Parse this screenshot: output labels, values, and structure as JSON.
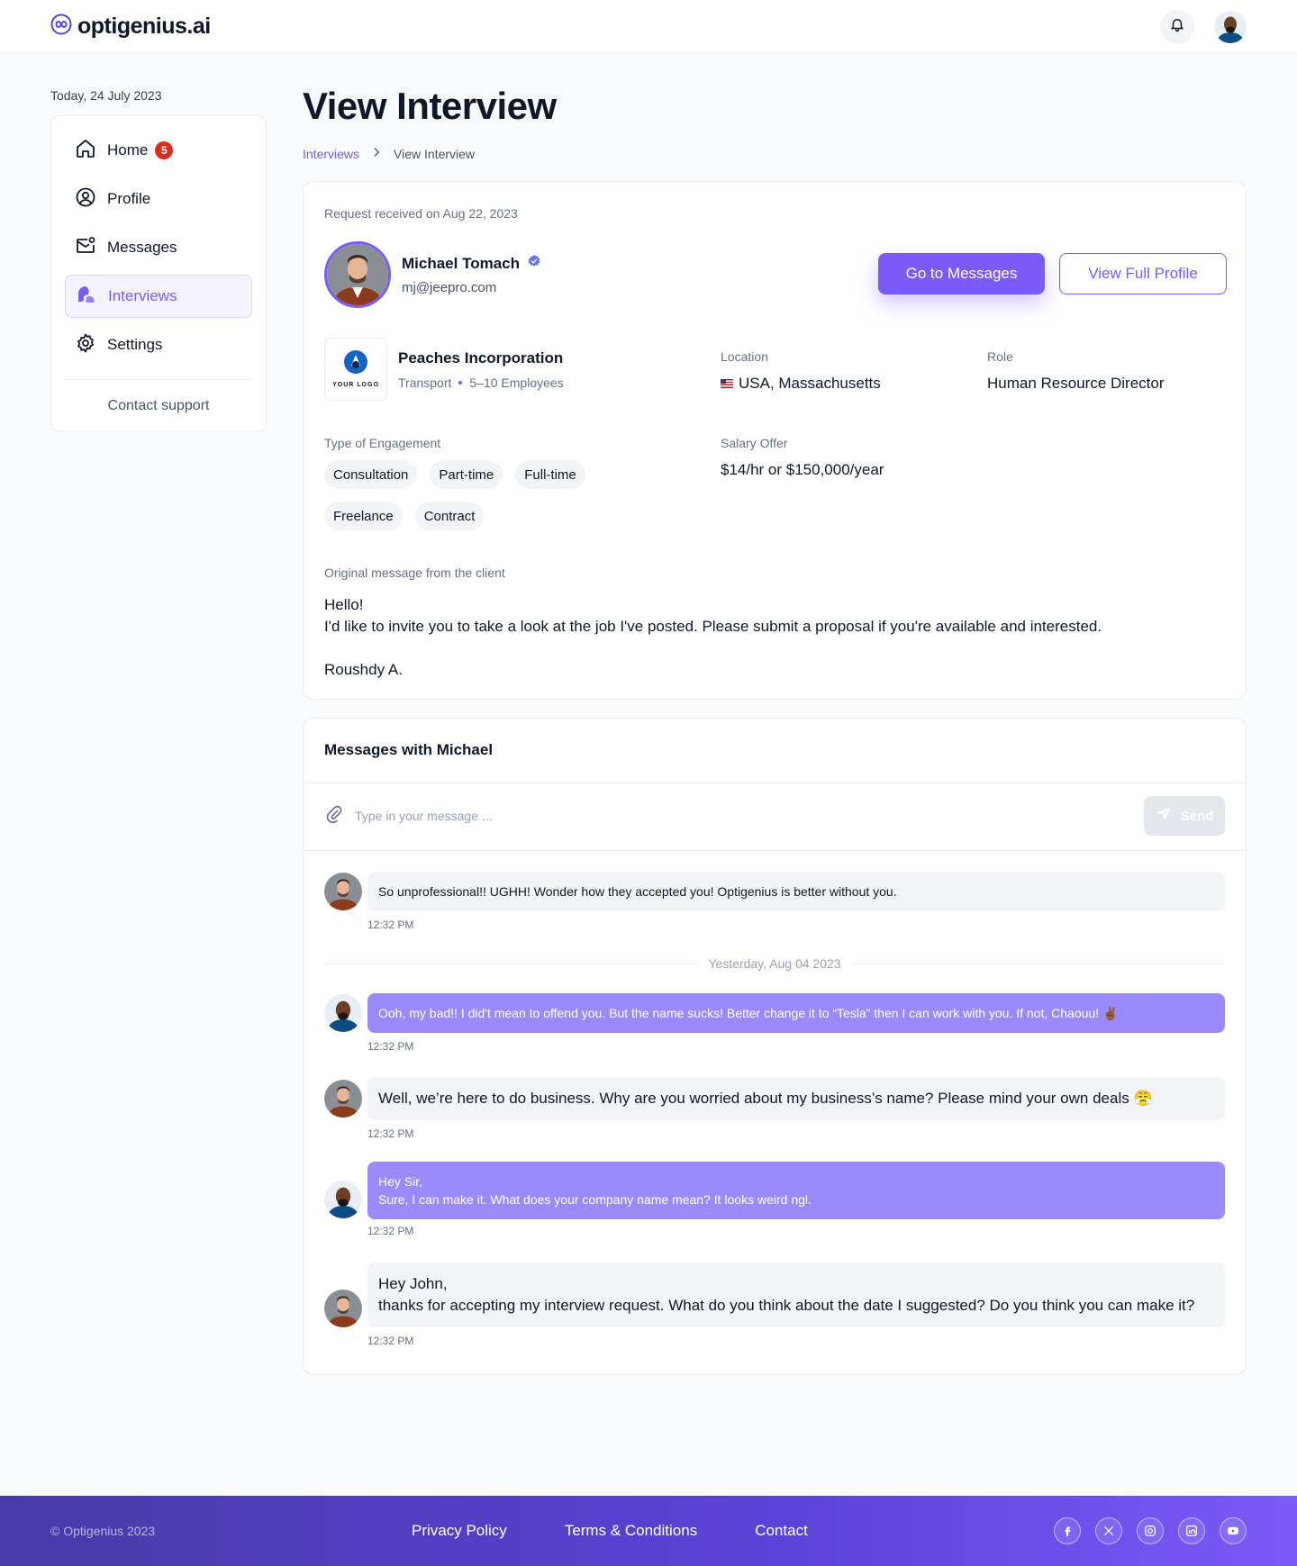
{
  "header": {
    "brand": "optigenius.ai",
    "icons": {
      "logo": "infinity-logo-icon",
      "notifications": "bell-icon"
    }
  },
  "sidebar": {
    "today": "Today, 24 July 2023",
    "items": [
      {
        "label": "Home",
        "icon": "home-icon",
        "badge": "5"
      },
      {
        "label": "Profile",
        "icon": "user-circle-icon"
      },
      {
        "label": "Messages",
        "icon": "mail-icon"
      },
      {
        "label": "Interviews",
        "icon": "interviews-icon",
        "active": true
      },
      {
        "label": "Settings",
        "icon": "gear-icon"
      }
    ],
    "contact_support": "Contact support"
  },
  "page": {
    "title": "View Interview",
    "breadcrumb": {
      "parent": "Interviews",
      "current": "View Interview"
    }
  },
  "interview": {
    "request_received": "Request received on Aug 22, 2023",
    "candidate": {
      "name": "Michael Tomach",
      "email": "mj@jeepro.com",
      "verified": true
    },
    "buttons": {
      "go_to_messages": "Go to Messages",
      "view_full_profile": "View Full Profile"
    },
    "company": {
      "logo_text": "YOUR LOGO",
      "name": "Peaches Incorporation",
      "industry": "Transport",
      "size": "5–10 Employees"
    },
    "location": {
      "label": "Location",
      "value": "USA, Massachusetts"
    },
    "role": {
      "label": "Role",
      "value": "Human Resource Director"
    },
    "engagement": {
      "label": "Type of Engagement",
      "types": [
        "Consultation",
        "Part-time",
        "Full-time",
        "Freelance",
        "Contract"
      ]
    },
    "salary": {
      "label": "Salary Offer",
      "value": "$14/hr or $150,000/year"
    },
    "original_message": {
      "label": "Original message from the client",
      "greeting": "Hello!",
      "body": "I'd like to invite you to take a look at the job I've posted. Please submit a proposal if you're available and interested.",
      "signature": "Roushdy A."
    }
  },
  "messages": {
    "title": "Messages with Michael",
    "compose_placeholder": "Type in your message ...",
    "send_label": "Send",
    "day_separator": "Yesterday, Aug 04 2023",
    "items": [
      {
        "from": "michael",
        "lines": [
          "So unprofessional!! UGHH! Wonder how  they accepted you! Optigenius is better without you."
        ],
        "time": "12:32 PM"
      },
      {
        "from": "me",
        "lines": [
          "Ooh, my bad!! I did't mean to offend you. But the name sucks! Better change it to “Tesla” then I can work with you. If not, Chaouu! ✌🏾"
        ],
        "time": "12:32 PM"
      },
      {
        "from": "michael",
        "lines": [
          "Well, we’re here to do business. Why are you worried about my business’s name? Please mind your own deals 😤"
        ],
        "time": "12:32 PM"
      },
      {
        "from": "me",
        "lines": [
          "Hey Sir,",
          "Sure, I can make it. What does your company name mean? It looks weird ngl."
        ],
        "time": "12:32 PM"
      },
      {
        "from": "michael",
        "lines": [
          "Hey John,",
          "thanks for accepting my interview request. What do you think about the date I suggested? Do you think you can make it?"
        ],
        "time": "12:32 PM"
      }
    ]
  },
  "footer": {
    "copyright": "© Optigenius  2023",
    "links": [
      "Privacy Policy",
      "Terms & Conditions",
      "Contact"
    ],
    "socials": [
      "facebook-icon",
      "x-icon",
      "instagram-icon",
      "linkedin-icon",
      "youtube-icon"
    ]
  },
  "colors": {
    "accent": "#7a5af8",
    "accent_light": "#9b8afb",
    "badge": "#d92d20"
  }
}
